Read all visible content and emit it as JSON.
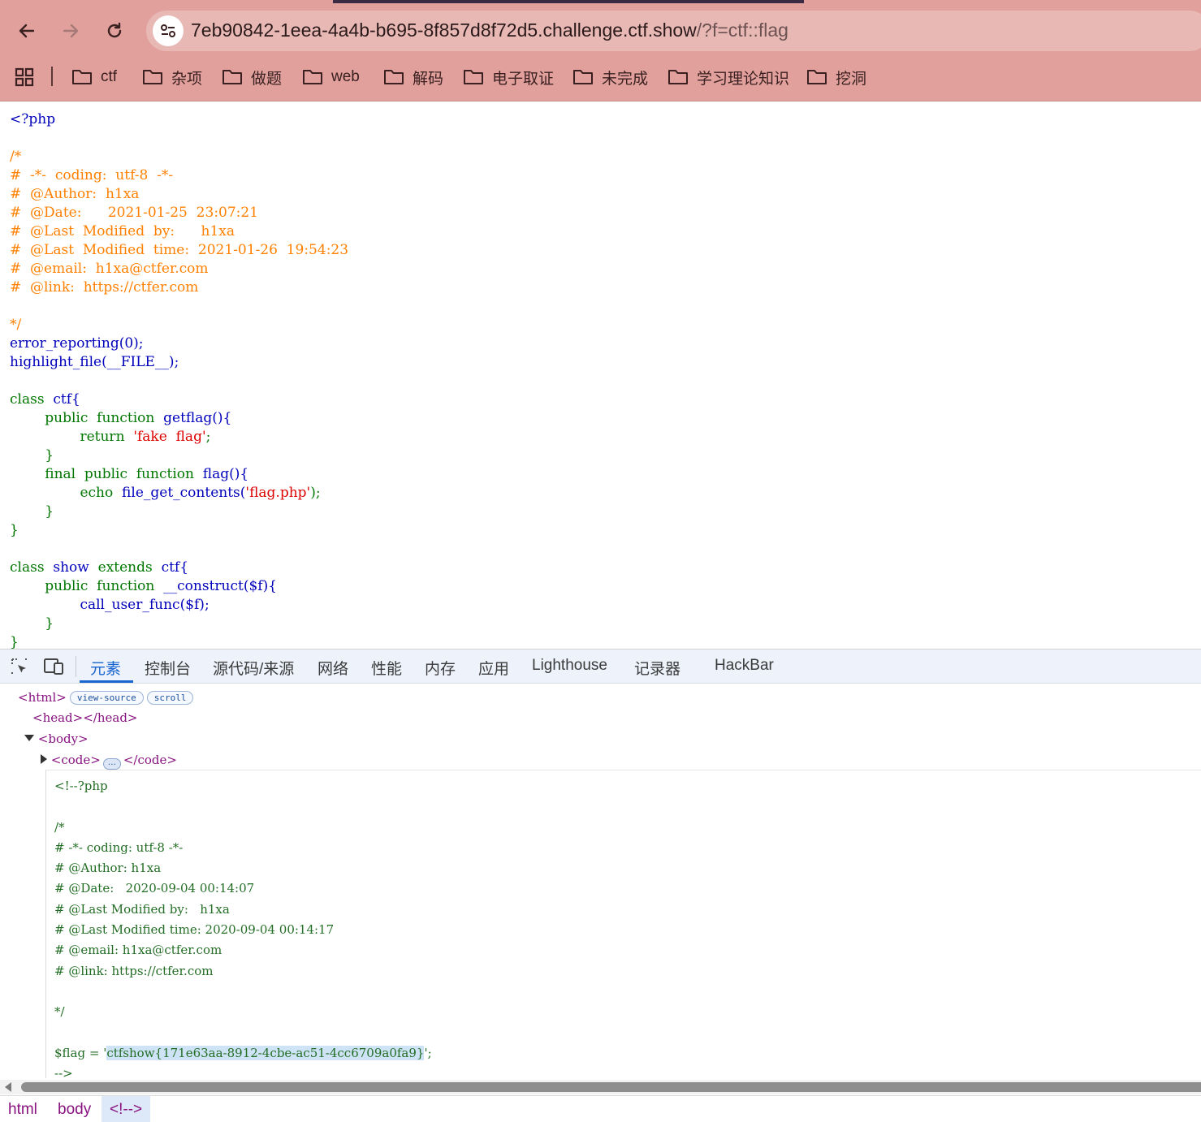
{
  "browser": {
    "url_host": "7eb90842-1eea-4a4b-b695-8f857d8f72d5.challenge.ctf.show",
    "url_path": "/?f=ctf::flag",
    "bookmarks": [
      "ctf",
      "杂项",
      "做题",
      "web",
      "解码",
      "电子取证",
      "未完成",
      "学习理论知识",
      "挖洞"
    ]
  },
  "code": {
    "open_tag": "<?php",
    "comment_open": "/*",
    "comment_lines": [
      "#  -*-  coding:  utf-8  -*-",
      "#  @Author:  h1xa",
      "#  @Date:      2021-01-25  23:07:21",
      "#  @Last  Modified  by:      h1xa",
      "#  @Last  Modified  time:  2021-01-26  19:54:23",
      "#  @email:  h1xa@ctfer.com",
      "#  @link:  https://ctfer.com"
    ],
    "comment_close": "*/",
    "line_error_reporting": "error_reporting(0);",
    "line_highlight": "highlight_file(__FILE__);",
    "class_ctf_kw": "class",
    "class_ctf_name": "ctf{",
    "getflag_kw": "public  function",
    "getflag_name": "getflag(){",
    "return_kw": "return",
    "return_str": "'fake  flag'",
    "semicolon": ";",
    "close_brace": "}",
    "flag_kw": "final  public  function",
    "flag_name": "flag(){",
    "echo_kw": "echo",
    "echo_call": "file_get_contents(",
    "echo_str": "'flag.php'",
    "echo_end": ");",
    "class_show_kw": "class",
    "class_show_name": "show",
    "extends_kw": "extends",
    "extends_name": "ctf{",
    "construct_kw": "public  function",
    "construct_name": "__construct($f){",
    "call_line": "call_user_func($f);"
  },
  "devtools": {
    "tabs": [
      "元素",
      "控制台",
      "源代码/来源",
      "网络",
      "性能",
      "内存",
      "应用",
      "Lighthouse",
      "记录器",
      "HackBar"
    ],
    "active_tab": "元素",
    "dom": {
      "html_open": "<html>",
      "pill_view_source": "view-source",
      "pill_scroll": "scroll",
      "head": "<head></head>",
      "body_open": "<body>",
      "code_open": "<code>",
      "code_close": "</code>",
      "ellipsis": "…"
    },
    "comment": {
      "lines": [
        "<!--?php",
        "",
        "/*",
        "# -*- coding: utf-8 -*-",
        "# @Author: h1xa",
        "# @Date:   2020-09-04 00:14:07",
        "# @Last Modified by:   h1xa",
        "# @Last Modified time: 2020-09-04 00:14:17",
        "# @email: h1xa@ctfer.com",
        "# @link: https://ctfer.com",
        "",
        "*/",
        ""
      ],
      "flag_prefix": "$flag = '",
      "flag_value": "ctfshow{171e63aa-8912-4cbe-ac51-4cc6709a0fa9}",
      "flag_suffix": "';",
      "comment_end": "-->"
    },
    "breadcrumbs": [
      "html",
      "body",
      "<!-->"
    ]
  }
}
